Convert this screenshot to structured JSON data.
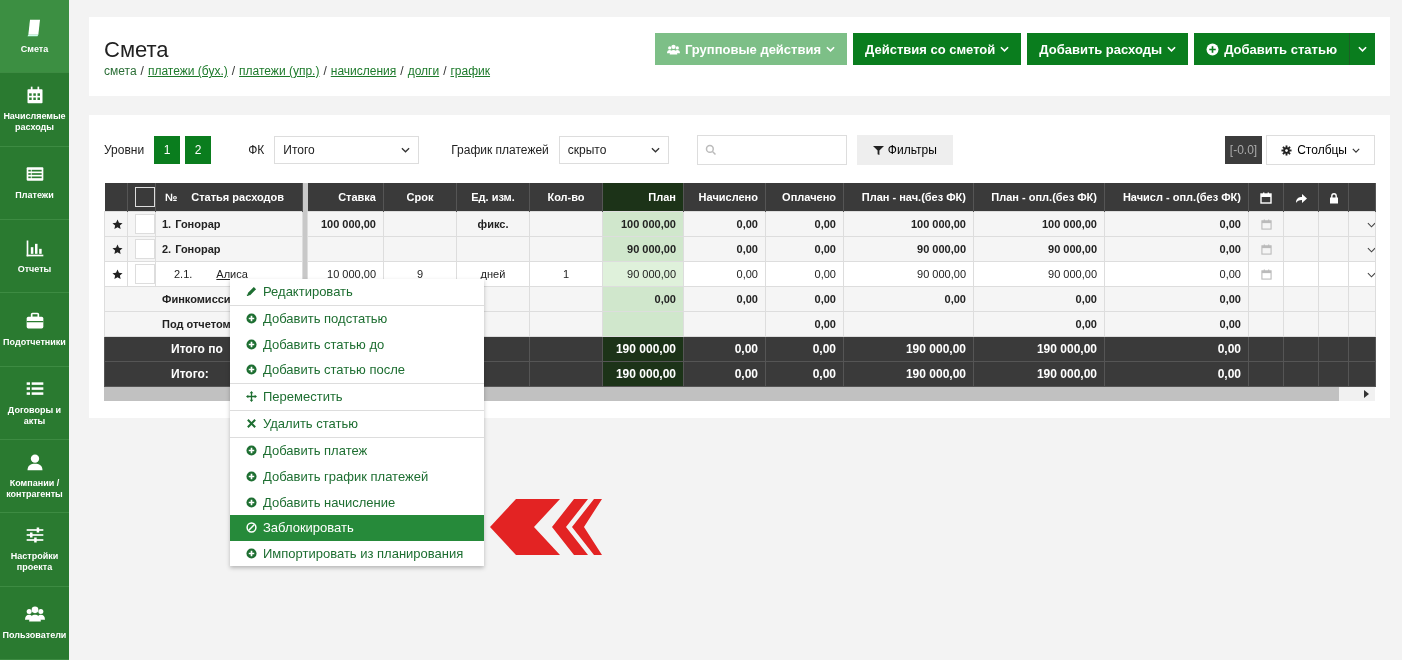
{
  "sidebar": {
    "items": [
      {
        "label": "Смета",
        "selected": true
      },
      {
        "label": "Начисляемые расходы",
        "selected": false
      },
      {
        "label": "Платежи",
        "selected": false
      },
      {
        "label": "Отчеты",
        "selected": false
      },
      {
        "label": "Подотчетники",
        "selected": false
      },
      {
        "label": "Договоры и акты",
        "selected": false
      },
      {
        "label": "Компании / контрагенты",
        "selected": false
      },
      {
        "label": "Настройки проекта",
        "selected": false
      },
      {
        "label": "Пользователи",
        "selected": false
      }
    ]
  },
  "header": {
    "title": "Смета",
    "breadcrumbs": [
      {
        "label": "смета",
        "kind": "current"
      },
      {
        "label": "/",
        "kind": "separator"
      },
      {
        "label": "платежи (бух.)",
        "kind": "link"
      },
      {
        "label": "/",
        "kind": "separator"
      },
      {
        "label": "платежи (упр.)",
        "kind": "link"
      },
      {
        "label": "/",
        "kind": "separator"
      },
      {
        "label": "начисления",
        "kind": "link"
      },
      {
        "label": "/",
        "kind": "separator"
      },
      {
        "label": "долги",
        "kind": "link"
      },
      {
        "label": "/",
        "kind": "separator"
      },
      {
        "label": "график",
        "kind": "link"
      }
    ],
    "buttons": [
      {
        "label": "Групповые действия",
        "kind": "group",
        "disabled": true
      },
      {
        "label": "Действия со сметой",
        "kind": "dropdown",
        "disabled": false
      },
      {
        "label": "Добавить расходы",
        "kind": "dropdown",
        "disabled": false
      },
      {
        "label": "Добавить статью",
        "kind": "split",
        "disabled": false
      }
    ]
  },
  "toolbar": {
    "levels_label": "Уровни",
    "levels": [
      "1",
      "2"
    ],
    "fk_label": "ФК",
    "fk_value": "Итого",
    "schedule_label": "График платежей",
    "schedule_value": "скрыто",
    "filters_button": "Фильтры",
    "rounding": "[-0.0]",
    "columns_button": "Столбцы"
  },
  "table": {
    "select_all_checked": false,
    "number_header": "№",
    "name_header": "Статья расходов",
    "columns": [
      "Ставка",
      "Срок",
      "Ед. изм.",
      "Кол-во",
      "План",
      "Начислено",
      "Оплачено",
      "План - нач.(без ФК)",
      "План - опл.(без ФК)",
      "Начисл - опл.(без ФК)"
    ],
    "rows": [
      {
        "kind": "item",
        "num": "1.",
        "name": "Гонорар",
        "checked": false,
        "cells": [
          "100 000,00",
          null,
          "фикс.",
          null,
          "100 000,00",
          "0,00",
          "0,00",
          "100 000,00",
          "100 000,00",
          "0,00"
        ]
      },
      {
        "kind": "item",
        "num": "2.",
        "name": "Гонорар",
        "checked": false,
        "cells": [
          null,
          null,
          null,
          null,
          "90 000,00",
          "0,00",
          "0,00",
          "90 000,00",
          "90 000,00",
          "0,00"
        ],
        "children": [
          {
            "kind": "item",
            "num": "2.1.",
            "name": "Алиса",
            "checked": false,
            "cells": [
              "10 000,00",
              "9",
              "дней",
              "1",
              "90 000,00",
              "0,00",
              "0,00",
              "90 000,00",
              "90 000,00",
              "0,00"
            ]
          }
        ]
      },
      {
        "kind": "summary",
        "name": "Финкомисси",
        "cells": [
          null,
          null,
          null,
          null,
          "0,00",
          "0,00",
          "0,00",
          "0,00",
          "0,00",
          "0,00"
        ]
      },
      {
        "kind": "summary",
        "name": "Под отчетом",
        "cells": [
          null,
          null,
          null,
          null,
          null,
          null,
          "0,00",
          null,
          "0,00",
          "0,00"
        ]
      },
      {
        "kind": "total",
        "name": "Итого по",
        "cells": [
          null,
          null,
          null,
          null,
          "190 000,00",
          "0,00",
          "0,00",
          "190 000,00",
          "190 000,00",
          "0,00"
        ]
      },
      {
        "kind": "total",
        "name": "Итого:",
        "cells": [
          null,
          null,
          null,
          null,
          "190 000,00",
          "0,00",
          "0,00",
          "190 000,00",
          "190 000,00",
          "0,00"
        ]
      }
    ]
  },
  "context_menu": {
    "items": [
      {
        "label": "Редактировать",
        "kind": "edit",
        "divider_before": false,
        "selected": false
      },
      {
        "label": "Добавить подстатью",
        "kind": "add",
        "divider_before": true,
        "selected": false
      },
      {
        "label": "Добавить статью до",
        "kind": "add",
        "divider_before": false,
        "selected": false
      },
      {
        "label": "Добавить статью после",
        "kind": "add",
        "divider_before": false,
        "selected": false
      },
      {
        "label": "Переместить",
        "kind": "move",
        "divider_before": true,
        "selected": false
      },
      {
        "label": "Удалить статью",
        "kind": "delete",
        "divider_before": true,
        "selected": false
      },
      {
        "label": "Добавить платеж",
        "kind": "add",
        "divider_before": true,
        "selected": false
      },
      {
        "label": "Добавить график платежей",
        "kind": "add",
        "divider_before": false,
        "selected": false
      },
      {
        "label": "Добавить начисление",
        "kind": "add",
        "divider_before": false,
        "selected": false
      },
      {
        "label": "Заблокировать",
        "kind": "block",
        "divider_before": false,
        "selected": true
      },
      {
        "label": "Импортировать из планирования",
        "kind": "add",
        "divider_before": false,
        "selected": false
      }
    ]
  }
}
